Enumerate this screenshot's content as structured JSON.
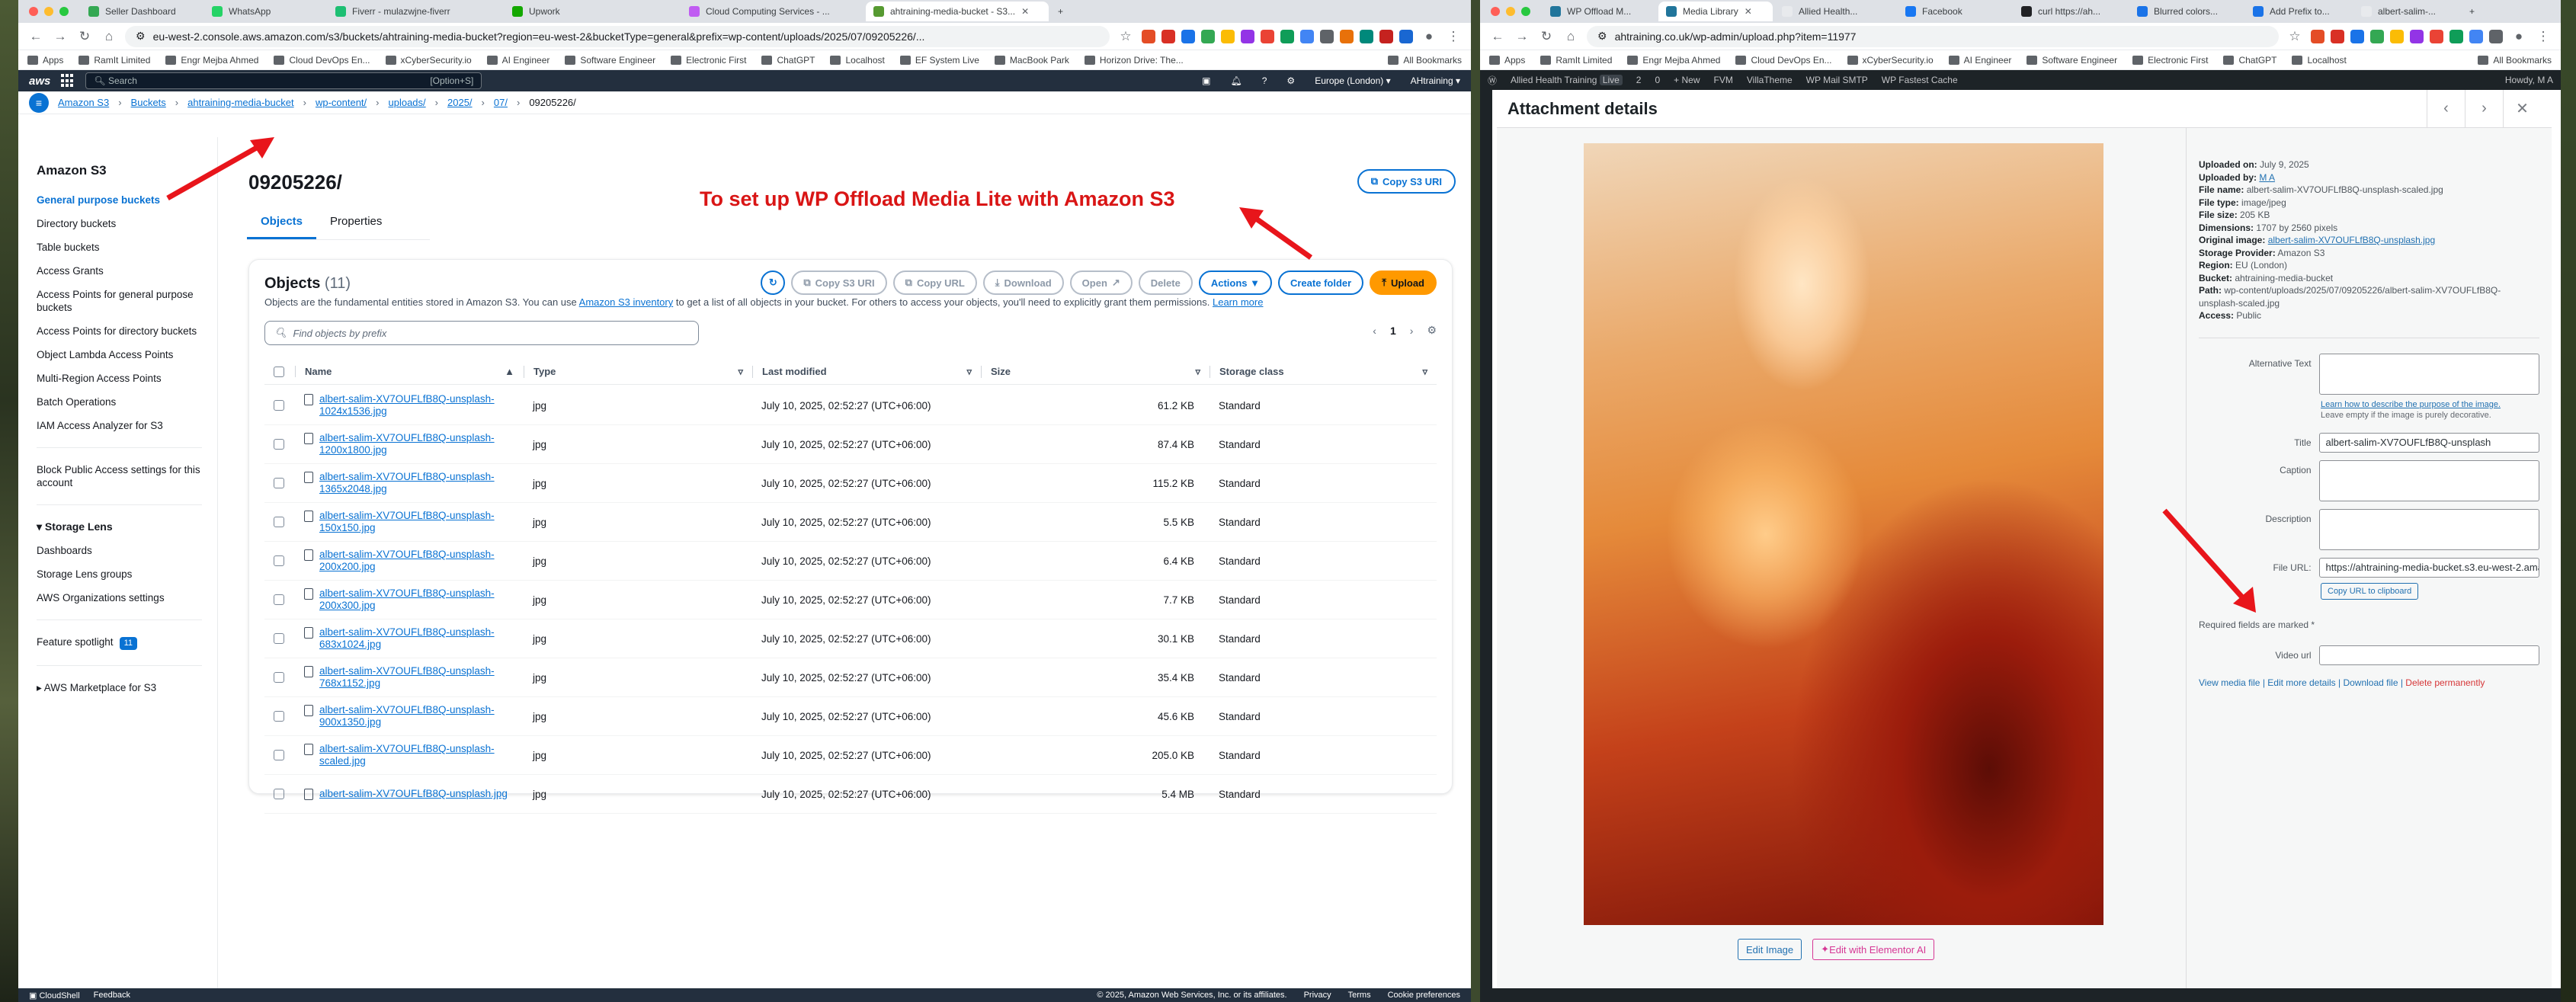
{
  "left_browser": {
    "tabs": [
      "Seller Dashboard",
      "WhatsApp",
      "Fiverr - mulazwjne-fiverr",
      "Upwork",
      "Cloud Computing Services - ...",
      "ahtraining-media-bucket - S3..."
    ],
    "url": "eu-west-2.console.aws.amazon.com/s3/buckets/ahtraining-media-bucket?region=eu-west-2&bucketType=general&prefix=wp-content/uploads/2025/07/09205226/...",
    "bookmarks": [
      "Apps",
      "RamIt Limited",
      "Engr Mejba Ahmed",
      "Cloud DevOps En...",
      "xCyberSecurity.io",
      "AI Engineer",
      "Software Engineer",
      "Electronic First",
      "ChatGPT",
      "Localhost",
      "EF System Live",
      "MacBook Park",
      "Horizon Drive: The...",
      "All Bookmarks"
    ]
  },
  "aws": {
    "search_placeholder": "Search",
    "search_shortcut": "[Option+S]",
    "region": "Europe (London) ▾",
    "account": "AHtraining ▾",
    "breadcrumb": [
      "Amazon S3",
      "Buckets",
      "ahtraining-media-bucket",
      "wp-content/",
      "uploads/",
      "2025/",
      "07/",
      "09205226/"
    ],
    "sidebar_title": "Amazon S3",
    "sidebar_items": [
      "General purpose buckets",
      "Directory buckets",
      "Table buckets",
      "Access Grants",
      "Access Points for general purpose buckets",
      "Access Points for directory buckets",
      "Object Lambda Access Points",
      "Multi-Region Access Points",
      "Batch Operations",
      "IAM Access Analyzer for S3"
    ],
    "sidebar_block": "Block Public Access settings for this account",
    "storage_lens": "Storage Lens",
    "storage_lens_items": [
      "Dashboards",
      "Storage Lens groups",
      "AWS Organizations settings"
    ],
    "feature_spotlight": "Feature spotlight",
    "feature_count": "11",
    "marketplace": "AWS Marketplace for S3",
    "page_title": "09205226/",
    "copy_uri": "Copy S3 URI",
    "tab_objects": "Objects",
    "tab_properties": "Properties",
    "annotation": "To set up WP Offload Media Lite with Amazon S3",
    "objects_heading": "Objects",
    "objects_count": "(11)",
    "objects_desc": "Objects are the fundamental entities stored in Amazon S3. You can use",
    "inventory_link": "Amazon S3 inventory",
    "objects_desc2": "to get a list of all objects in your bucket. For others to access your objects, you'll need to explicitly grant them permissions.",
    "learn_more": "Learn more",
    "buttons": {
      "copy_s3_uri": "Copy S3 URI",
      "copy_url": "Copy URL",
      "download": "Download",
      "open": "Open",
      "delete": "Delete",
      "actions": "Actions ▼",
      "create_folder": "Create folder",
      "upload": "Upload"
    },
    "find_placeholder": "Find objects by prefix",
    "page_num": "1",
    "columns": [
      "Name",
      "Type",
      "Last modified",
      "Size",
      "Storage class"
    ],
    "rows": [
      {
        "name": "albert-salim-XV7OUFLfB8Q-unsplash-1024x1536.jpg",
        "type": "jpg",
        "modified": "July 10, 2025, 02:52:27 (UTC+06:00)",
        "size": "61.2 KB",
        "class": "Standard"
      },
      {
        "name": "albert-salim-XV7OUFLfB8Q-unsplash-1200x1800.jpg",
        "type": "jpg",
        "modified": "July 10, 2025, 02:52:27 (UTC+06:00)",
        "size": "87.4 KB",
        "class": "Standard"
      },
      {
        "name": "albert-salim-XV7OUFLfB8Q-unsplash-1365x2048.jpg",
        "type": "jpg",
        "modified": "July 10, 2025, 02:52:27 (UTC+06:00)",
        "size": "115.2 KB",
        "class": "Standard"
      },
      {
        "name": "albert-salim-XV7OUFLfB8Q-unsplash-150x150.jpg",
        "type": "jpg",
        "modified": "July 10, 2025, 02:52:27 (UTC+06:00)",
        "size": "5.5 KB",
        "class": "Standard"
      },
      {
        "name": "albert-salim-XV7OUFLfB8Q-unsplash-200x200.jpg",
        "type": "jpg",
        "modified": "July 10, 2025, 02:52:27 (UTC+06:00)",
        "size": "6.4 KB",
        "class": "Standard"
      },
      {
        "name": "albert-salim-XV7OUFLfB8Q-unsplash-200x300.jpg",
        "type": "jpg",
        "modified": "July 10, 2025, 02:52:27 (UTC+06:00)",
        "size": "7.7 KB",
        "class": "Standard"
      },
      {
        "name": "albert-salim-XV7OUFLfB8Q-unsplash-683x1024.jpg",
        "type": "jpg",
        "modified": "July 10, 2025, 02:52:27 (UTC+06:00)",
        "size": "30.1 KB",
        "class": "Standard"
      },
      {
        "name": "albert-salim-XV7OUFLfB8Q-unsplash-768x1152.jpg",
        "type": "jpg",
        "modified": "July 10, 2025, 02:52:27 (UTC+06:00)",
        "size": "35.4 KB",
        "class": "Standard"
      },
      {
        "name": "albert-salim-XV7OUFLfB8Q-unsplash-900x1350.jpg",
        "type": "jpg",
        "modified": "July 10, 2025, 02:52:27 (UTC+06:00)",
        "size": "45.6 KB",
        "class": "Standard"
      },
      {
        "name": "albert-salim-XV7OUFLfB8Q-unsplash-scaled.jpg",
        "type": "jpg",
        "modified": "July 10, 2025, 02:52:27 (UTC+06:00)",
        "size": "205.0 KB",
        "class": "Standard"
      },
      {
        "name": "albert-salim-XV7OUFLfB8Q-unsplash.jpg",
        "type": "jpg",
        "modified": "July 10, 2025, 02:52:27 (UTC+06:00)",
        "size": "5.4 MB",
        "class": "Standard"
      }
    ],
    "footer_left": [
      "CloudShell",
      "Feedback"
    ],
    "footer_right": [
      "© 2025, Amazon Web Services, Inc. or its affiliates.",
      "Privacy",
      "Terms",
      "Cookie preferences"
    ]
  },
  "right_browser": {
    "tabs": [
      "WP Offload M...",
      "Media Library",
      "Allied Health...",
      "Facebook",
      "curl https://ah...",
      "Blurred colors...",
      "Add Prefix to...",
      "albert-salim-..."
    ],
    "url": "ahtraining.co.uk/wp-admin/upload.php?item=11977",
    "bookmarks": [
      "Apps",
      "RamIt Limited",
      "Engr Mejba Ahmed",
      "Cloud DevOps En...",
      "xCyberSecurity.io",
      "AI Engineer",
      "Software Engineer",
      "Electronic First",
      "ChatGPT",
      "Localhost",
      "All Bookmarks"
    ],
    "adminbar": [
      "Allied Health Training",
      "Live",
      "2",
      "0",
      "+ New",
      "FVM",
      "VillaTheme",
      "WP Mail SMTP",
      "WP Fastest Cache",
      "Howdy, M A"
    ]
  },
  "wp": {
    "modal_title": "Attachment details",
    "edit_image": "Edit Image",
    "edit_elementor": "Edit with Elementor AI",
    "meta": [
      {
        "k": "Uploaded on:",
        "v": "July 9, 2025"
      },
      {
        "k": "Uploaded by:",
        "v": "M A"
      },
      {
        "k": "File name:",
        "v": "albert-salim-XV7OUFLfB8Q-unsplash-scaled.jpg"
      },
      {
        "k": "File type:",
        "v": "image/jpeg"
      },
      {
        "k": "File size:",
        "v": "205 KB"
      },
      {
        "k": "Dimensions:",
        "v": "1707 by 2560 pixels"
      },
      {
        "k": "Original image:",
        "v": "albert-salim-XV7OUFLfB8Q-unsplash.jpg"
      },
      {
        "k": "Storage Provider:",
        "v": "Amazon S3"
      },
      {
        "k": "Region:",
        "v": "EU (London)"
      },
      {
        "k": "Bucket:",
        "v": "ahtraining-media-bucket"
      },
      {
        "k": "Path:",
        "v": "wp-content/uploads/2025/07/09205226/albert-salim-XV7OUFLfB8Q-unsplash-scaled.jpg"
      },
      {
        "k": "Access:",
        "v": "Public"
      }
    ],
    "alt_label": "Alternative Text",
    "alt_help_link": "Learn how to describe the purpose of the image.",
    "alt_help_text": "Leave empty if the image is purely decorative.",
    "title_label": "Title",
    "title_value": "albert-salim-XV7OUFLfB8Q-unsplash",
    "caption_label": "Caption",
    "description_label": "Description",
    "file_url_label": "File URL:",
    "file_url_value": "https://ahtraining-media-bucket.s3.eu-west-2.amazonaws.com/",
    "copy_url": "Copy URL to clipboard",
    "required_note": "Required fields are marked *",
    "video_label": "Video url",
    "view_media": "View media file",
    "edit_more": "Edit more details",
    "download_file": "Download file",
    "delete_perm": "Delete permanently"
  }
}
